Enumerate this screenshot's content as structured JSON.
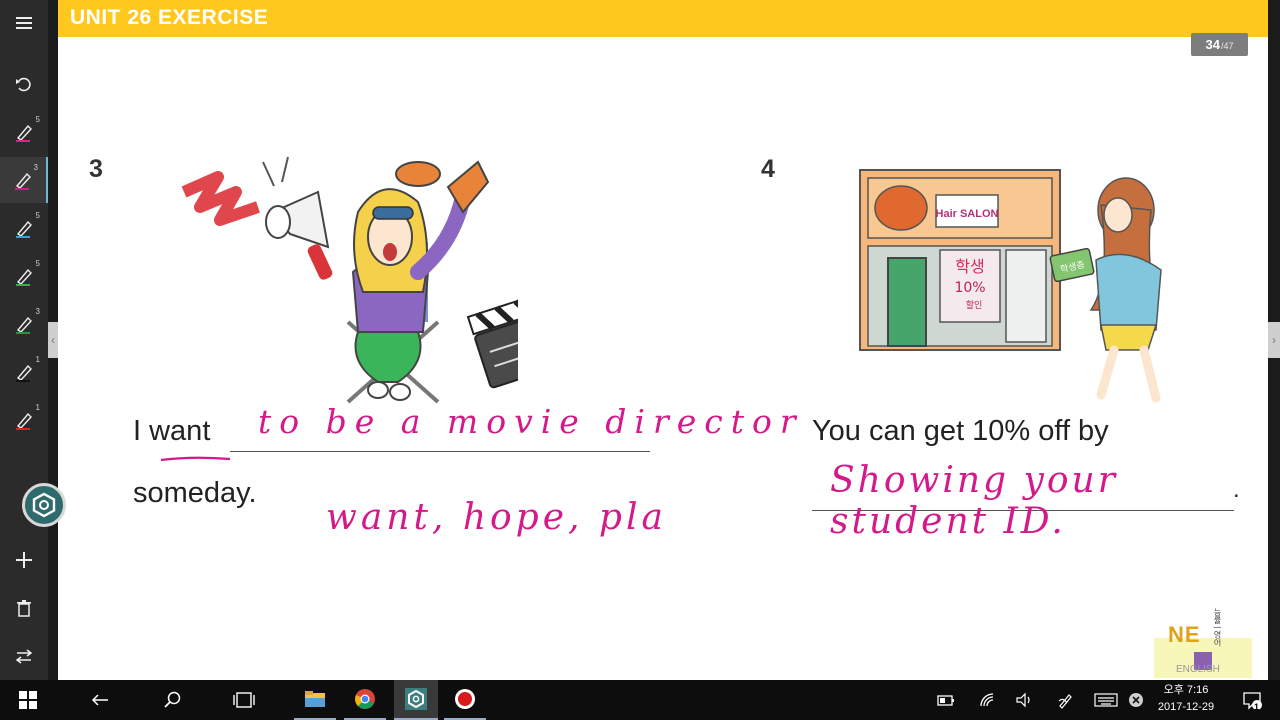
{
  "header": {
    "title": "UNIT 26  EXERCISE"
  },
  "pagination": {
    "current": "34",
    "total": "/47"
  },
  "toolbar": {
    "pen_counts": [
      "5",
      "3",
      "5",
      "5",
      "3",
      "1",
      "1"
    ]
  },
  "exercises": [
    {
      "number": "3",
      "prefix": "I want",
      "suffix": "someday.",
      "handwritten_answer": "to be a movie director",
      "handwritten_note": "want, hope, pla"
    },
    {
      "number": "4",
      "prefix": "You can get 10% off by",
      "suffix": ".",
      "handwritten_answer": "Showing your student ID."
    }
  ],
  "illustrations": {
    "salon_sign": "Hair SALON",
    "poster_lines": [
      "학생",
      "10%",
      "할인"
    ],
    "card_text": "학생증"
  },
  "logo": {
    "brand": "NE",
    "sub": "ENGLISH",
    "side": "능률 | 영어"
  },
  "taskbar": {
    "time": "오후 7:16",
    "date": "2017-12-29",
    "notification_count": "1"
  },
  "colors": {
    "header": "#ffc81e",
    "handwriting": "#d5198a",
    "accent": "#2f6a6c"
  }
}
